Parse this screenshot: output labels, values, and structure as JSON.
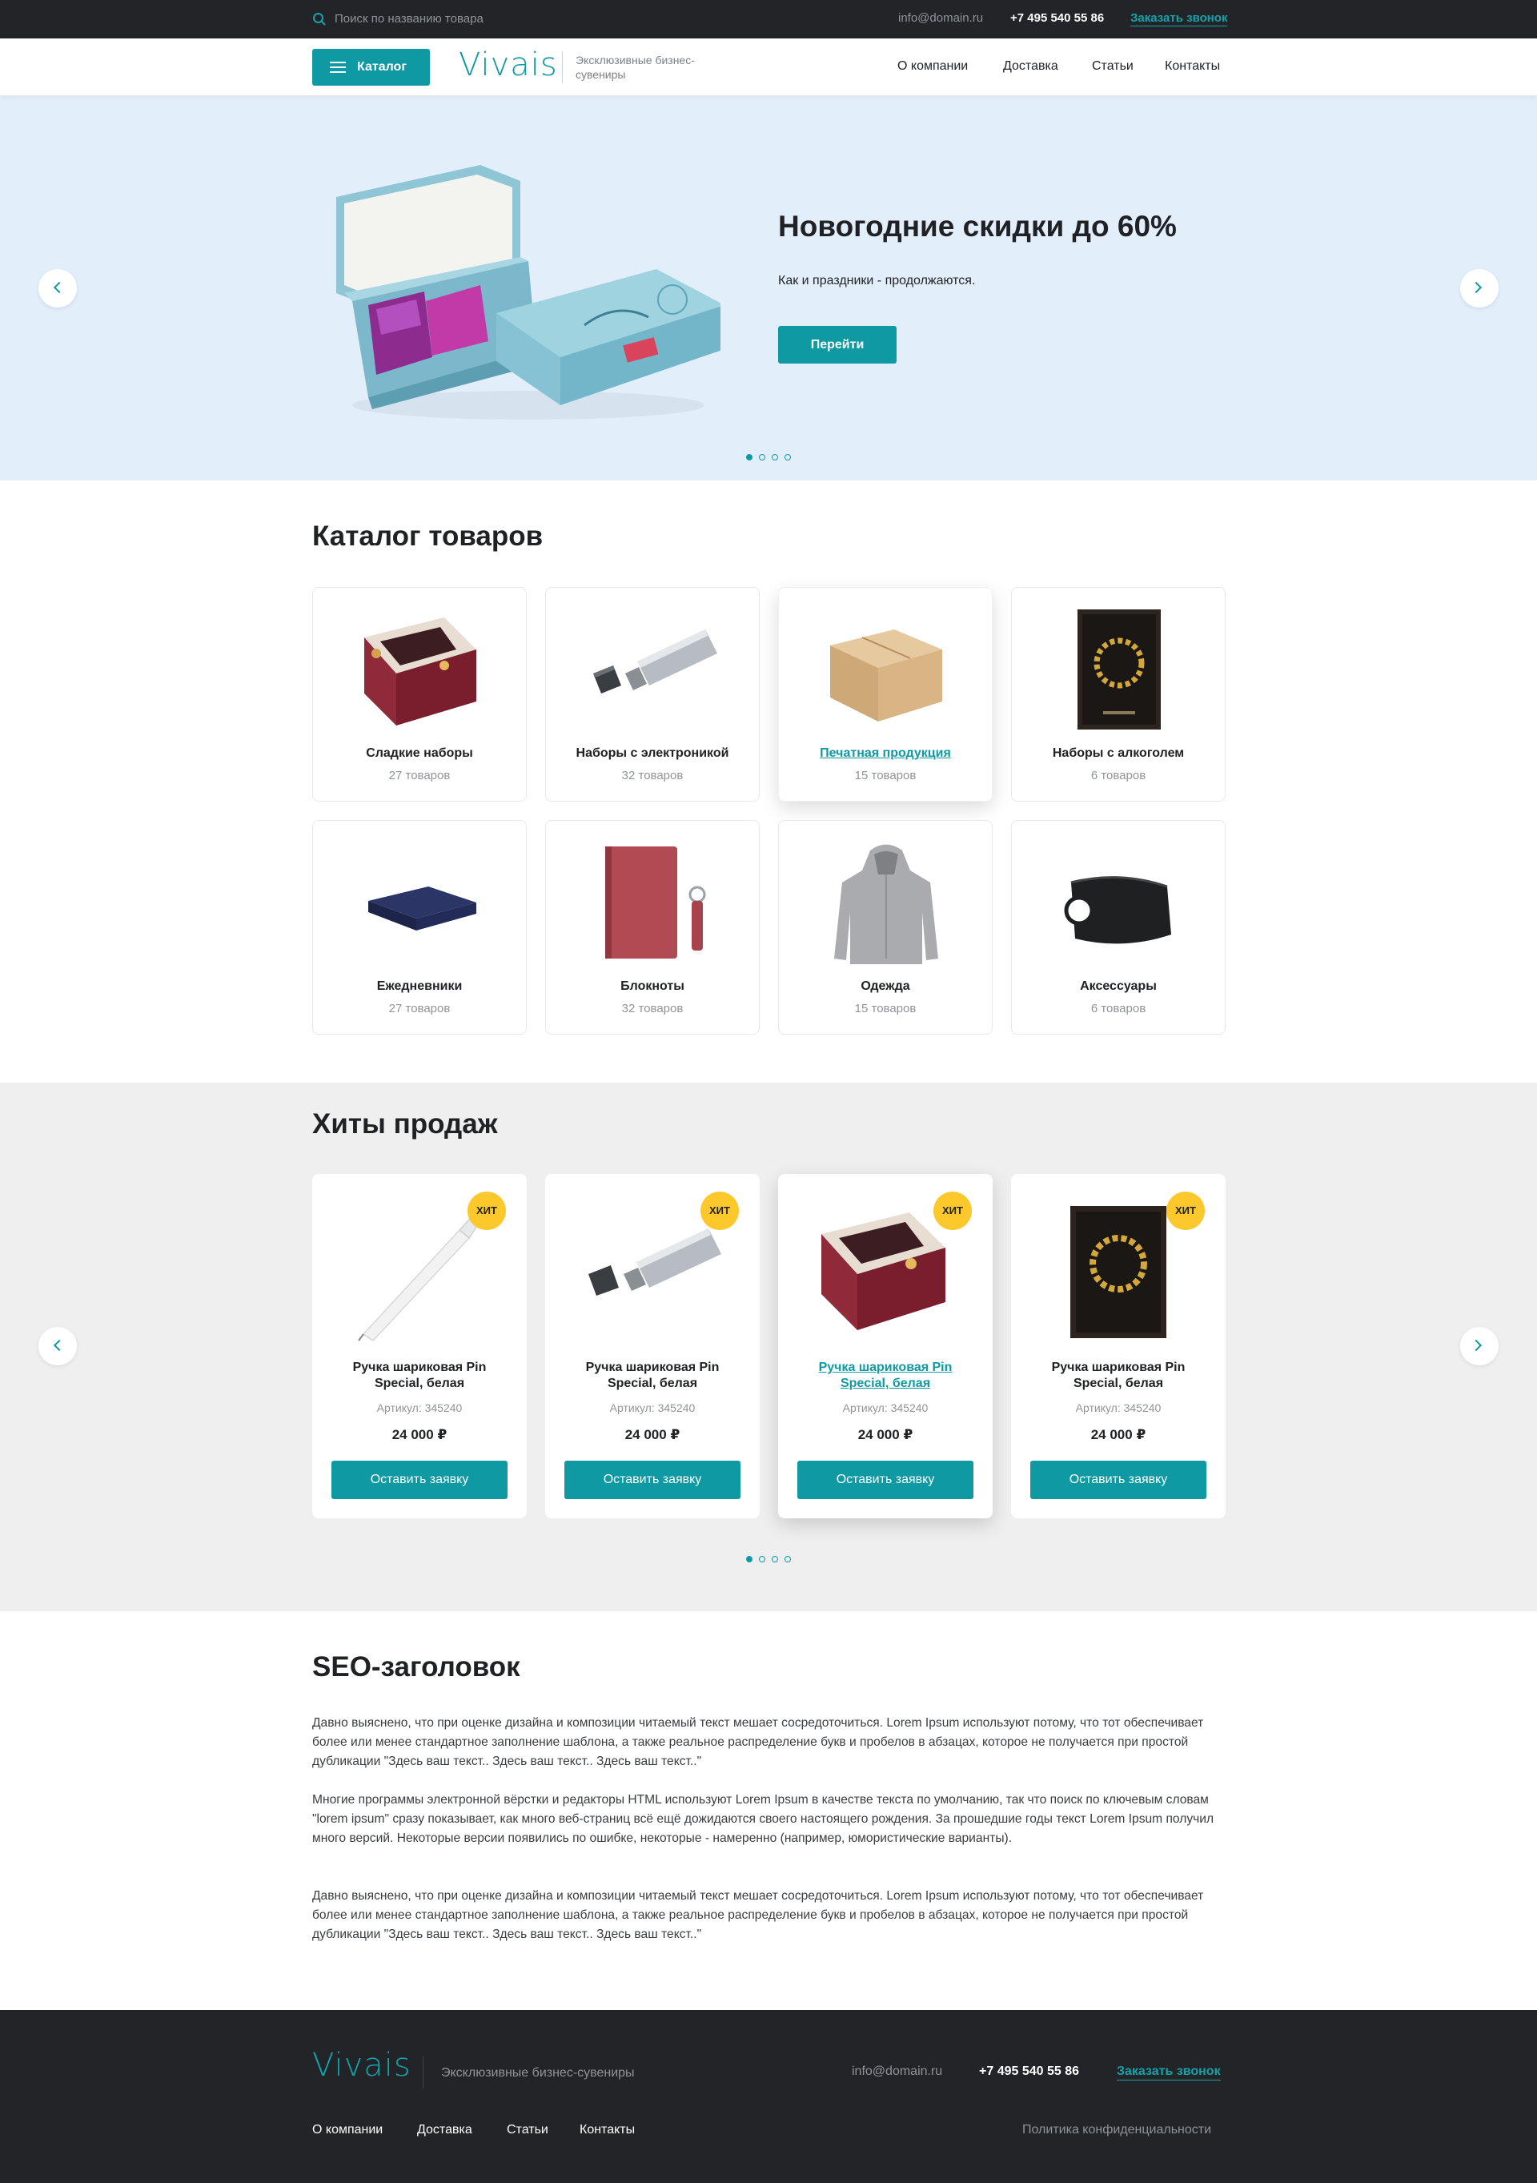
{
  "topbar": {
    "search_placeholder": "Поиск по названию товара",
    "email": "info@domain.ru",
    "phone": "+7 495 540 55 86",
    "callback": "Заказать звонок"
  },
  "header": {
    "catalog_label": "Каталог",
    "logo": "Vivais",
    "tagline": "Эксклюзивные бизнес-сувениры",
    "nav": [
      "О компании",
      "Доставка",
      "Статьи",
      "Контакты"
    ]
  },
  "hero": {
    "title": "Новогодние скидки до 60%",
    "subtitle": "Как и праздники - продолжаются.",
    "button": "Перейти",
    "slides": 4,
    "active_slide": 1
  },
  "catalog": {
    "title": "Каталог товаров",
    "items": [
      {
        "name": "Сладкие наборы",
        "count": "27 товаров",
        "icon": "sweet-box-icon"
      },
      {
        "name": "Наборы с электроникой",
        "count": "32 товаров",
        "icon": "usb-drive-icon"
      },
      {
        "name": "Печатная продукция",
        "count": "15 товаров",
        "icon": "cardboard-box-icon"
      },
      {
        "name": "Наборы с алкоголем",
        "count": "6 товаров",
        "icon": "framed-wreath-icon"
      },
      {
        "name": "Ежедневники",
        "count": "27 товаров",
        "icon": "flat-box-icon"
      },
      {
        "name": "Блокноты",
        "count": "32 товаров",
        "icon": "notebook-icon"
      },
      {
        "name": "Одежда",
        "count": "15 товаров",
        "icon": "hoodie-icon"
      },
      {
        "name": "Аксессуары",
        "count": "6 товаров",
        "icon": "pouch-icon"
      }
    ]
  },
  "hits": {
    "title": "Хиты продаж",
    "badge": "ХИТ",
    "items": [
      {
        "name": "Ручка шариковая Pin Special, белая",
        "article": "Артикул: 345240",
        "price": "24 000 ₽",
        "button": "Оставить заявку",
        "icon": "pen-icon"
      },
      {
        "name": "Ручка шариковая Pin Special, белая",
        "article": "Артикул: 345240",
        "price": "24 000 ₽",
        "button": "Оставить заявку",
        "icon": "usb-drive-icon"
      },
      {
        "name": "Ручка шариковая Pin Special, белая",
        "article": "Артикул: 345240",
        "price": "24 000 ₽",
        "button": "Оставить заявку",
        "icon": "sweet-box-icon"
      },
      {
        "name": "Ручка шариковая Pin Special, белая",
        "article": "Артикул: 345240",
        "price": "24 000 ₽",
        "button": "Оставить заявку",
        "icon": "framed-wreath-icon"
      }
    ],
    "slides": 4,
    "active_slide": 1
  },
  "seo": {
    "title": "SEO-заголовок",
    "paragraphs": [
      "Давно выяснено, что при оценке дизайна и композиции читаемый текст мешает сосредоточиться. Lorem Ipsum используют потому, что тот обеспечивает более или менее стандартное заполнение шаблона, а также реальное распределение букв и пробелов в абзацах, которое не получается при простой дубликации \"Здесь ваш текст.. Здесь ваш текст.. Здесь ваш текст..\"",
      "Многие программы электронной вёрстки и редакторы HTML используют Lorem Ipsum в качестве текста по умолчанию, так что поиск по ключевым словам \"lorem ipsum\" сразу показывает, как много веб-страниц всё ещё дожидаются своего настоящего рождения. За прошедшие годы текст Lorem Ipsum получил много версий. Некоторые версии появились по ошибке, некоторые - намеренно (например, юмористические варианты).",
      "Давно выяснено, что при оценке дизайна и композиции читаемый текст мешает сосредоточиться. Lorem Ipsum используют потому, что тот обеспечивает более или менее стандартное заполнение шаблона, а также реальное распределение букв и пробелов в абзацах, которое не получается при простой дубликации \"Здесь ваш текст.. Здесь ваш текст.. Здесь ваш текст..\""
    ]
  },
  "footer": {
    "logo": "Vivais",
    "tagline": "Эксклюзивные бизнес-сувениры",
    "email": "info@domain.ru",
    "phone": "+7 495 540 55 86",
    "callback": "Заказать звонок",
    "nav": [
      "О компании",
      "Доставка",
      "Статьи",
      "Контакты"
    ],
    "policy": "Политика конфиденциальности"
  },
  "colors": {
    "accent": "#0f9aa3",
    "dark": "#222427",
    "hero_bg": "#e3eefb",
    "badge": "#fcc82b"
  }
}
